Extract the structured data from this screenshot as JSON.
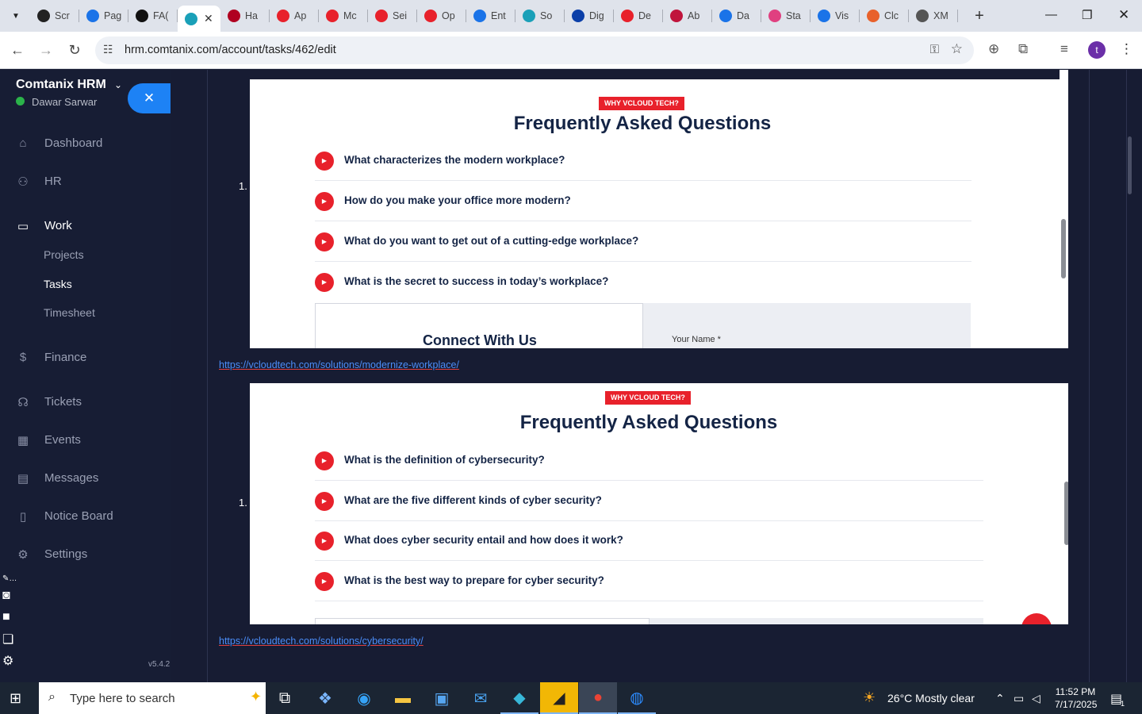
{
  "browser": {
    "tabs": [
      {
        "title": "Scr",
        "icon": "screen-icon",
        "color": "#222"
      },
      {
        "title": "Pag",
        "icon": "speed-icon",
        "color": "#1a73e8"
      },
      {
        "title": "FA(",
        "icon": "openai-icon",
        "color": "#111"
      },
      {
        "title": "",
        "icon": "comtanix-icon",
        "color": "#1aa0b8",
        "active": true
      },
      {
        "title": "Ha",
        "icon": "v-icon",
        "color": "#b00020"
      },
      {
        "title": "Ap",
        "icon": "diamond-icon",
        "color": "#e8212b"
      },
      {
        "title": "Mc",
        "icon": "diamond-icon",
        "color": "#e8212b"
      },
      {
        "title": "Sei",
        "icon": "diamond-icon",
        "color": "#e8212b"
      },
      {
        "title": "Op",
        "icon": "diamond-icon",
        "color": "#e8212b"
      },
      {
        "title": "Ent",
        "icon": "check-icon",
        "color": "#1a73e8"
      },
      {
        "title": "So",
        "icon": "globe-icon",
        "color": "#1aa0b8"
      },
      {
        "title": "Dig",
        "icon": "x-icon",
        "color": "#0b3fa8"
      },
      {
        "title": "De",
        "icon": "diamond-icon",
        "color": "#e8212b"
      },
      {
        "title": "Ab",
        "icon": "ball-icon",
        "color": "#c0143c"
      },
      {
        "title": "Da",
        "icon": "scales-icon",
        "color": "#1a73e8"
      },
      {
        "title": "Sta",
        "icon": "bolt-icon",
        "color": "#e04080"
      },
      {
        "title": "Vis",
        "icon": "pulse-icon",
        "color": "#1a73e8"
      },
      {
        "title": "Clc",
        "icon": "slash-icon",
        "color": "#e8612b"
      },
      {
        "title": "XM",
        "icon": "globe-icon",
        "color": "#555"
      }
    ],
    "url": "hrm.comtanix.com/account/tasks/462/edit"
  },
  "sidebar": {
    "brand": "Comtanix HRM",
    "user": "Dawar Sarwar",
    "items": [
      {
        "label": "Dashboard",
        "icon": "house-icon"
      },
      {
        "label": "HR",
        "icon": "users-icon"
      },
      {
        "label": "Work",
        "icon": "briefcase-icon"
      },
      {
        "label": "Finance",
        "icon": "dollar-icon"
      },
      {
        "label": "Tickets",
        "icon": "headset-icon"
      },
      {
        "label": "Events",
        "icon": "calendar-icon"
      },
      {
        "label": "Messages",
        "icon": "message-icon"
      },
      {
        "label": "Notice Board",
        "icon": "clipboard-icon"
      },
      {
        "label": "Settings",
        "icon": "gear-icon"
      }
    ],
    "work_sub": [
      "Projects",
      "Tasks",
      "Timesheet"
    ],
    "version": "v5.4.2"
  },
  "content": {
    "blocks": [
      {
        "number": "1.",
        "badge": "WHY VCLOUD TECH?",
        "title": "Frequently Asked Questions",
        "questions": [
          "What characterizes the modern workplace?",
          "How do you make your office more modern?",
          "What do you want to get out of a cutting-edge workplace?",
          "What is the secret to success in today’s workplace?"
        ],
        "form_heading": "Connect With Us",
        "form_label": "Your Name *",
        "link": "https://vcloudtech.com/solutions/modernize-workplace/"
      },
      {
        "number": "1.",
        "badge": "WHY VCLOUD TECH?",
        "title": "Frequently Asked Questions",
        "questions": [
          "What is the definition of cybersecurity?",
          "What are the five different kinds of cyber security?",
          "What does cyber security entail and how does it work?",
          "What is the best way to prepare for cyber security?"
        ],
        "link": "https://vcloudtech.com/solutions/cybersecurity/"
      }
    ]
  },
  "taskbar": {
    "search_placeholder": "Type here to search",
    "weather": "26°C  Mostly clear",
    "time": "11:52 PM",
    "date": "7/17/2025",
    "notification_count": "1"
  }
}
